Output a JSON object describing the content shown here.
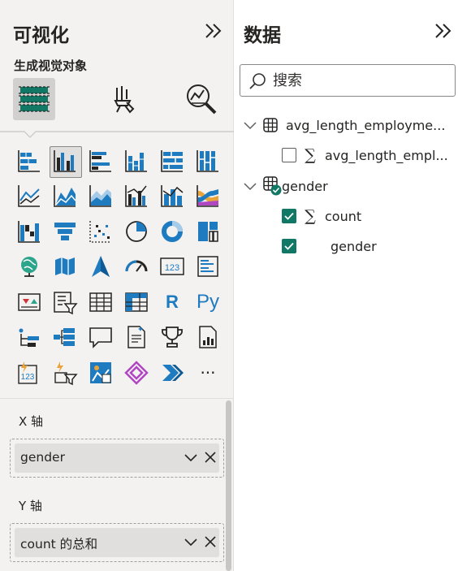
{
  "viz_pane": {
    "title": "可视化",
    "subtitle": "生成视觉对象",
    "build_tabs": [
      "fields-well-icon",
      "format-paintbrush-icon",
      "analytics-magnifier-icon"
    ],
    "visual_types": [
      "stacked-bar-chart-icon",
      "clustered-column-chart-icon",
      "clustered-bar-chart-icon",
      "stacked-column-chart-icon",
      "100-stacked-bar-chart-icon",
      "100-stacked-column-chart-icon",
      "line-chart-icon",
      "area-chart-icon",
      "stacked-area-chart-icon",
      "line-clustered-column-icon",
      "line-stacked-column-icon",
      "ribbon-chart-icon",
      "waterfall-chart-icon",
      "funnel-chart-icon",
      "scatter-chart-icon",
      "pie-chart-icon",
      "donut-chart-icon",
      "treemap-icon",
      "map-icon",
      "filled-map-icon",
      "azure-map-icon",
      "gauge-icon",
      "card-icon",
      "multi-row-card-icon",
      "kpi-icon",
      "slicer-icon",
      "table-icon",
      "matrix-icon",
      "r-visual-icon",
      "python-visual-icon",
      "key-influencers-icon",
      "decomposition-tree-icon",
      "qa-icon",
      "smart-narrative-icon",
      "metrics-icon",
      "paginated-report-icon",
      "power-apps-icon",
      "power-automate-icon",
      "arcgis-map-icon",
      "get-more-visuals-icon",
      "power-automate-flow-icon",
      "more-options-icon"
    ],
    "r_label": "R",
    "py_label": "Py",
    "more_label": "···",
    "card_label": "123",
    "wells": [
      {
        "label": "X 轴",
        "field": "gender"
      },
      {
        "label": "Y 轴",
        "field": "count 的总和"
      }
    ]
  },
  "data_pane": {
    "title": "数据",
    "search_placeholder": "搜索",
    "tables": [
      {
        "name": "avg_length_employme...",
        "fields": [
          {
            "name": "avg_length_empl...",
            "checked": false,
            "aggregate": true
          }
        ]
      },
      {
        "name": "gender",
        "fields": [
          {
            "name": "count",
            "checked": true,
            "aggregate": true
          },
          {
            "name": "gender",
            "checked": true,
            "aggregate": false
          }
        ]
      }
    ]
  },
  "colors": {
    "accent_teal": "#117865",
    "icon_blue": "#1f7bc0",
    "icon_dark": "#252423"
  }
}
